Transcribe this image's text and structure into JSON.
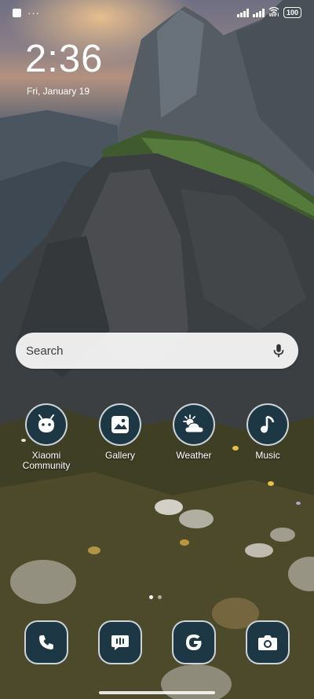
{
  "status_bar": {
    "battery": "100"
  },
  "lock": {
    "time": "2:36",
    "date": "Fri, January 19"
  },
  "search": {
    "placeholder": "Search"
  },
  "apps": [
    {
      "label": "Xiaomi\nCommunity",
      "icon": "xiaomi-community-icon"
    },
    {
      "label": "Gallery",
      "icon": "gallery-icon"
    },
    {
      "label": "Weather",
      "icon": "weather-icon"
    },
    {
      "label": "Music",
      "icon": "music-icon"
    }
  ],
  "dock": [
    {
      "icon": "phone-icon"
    },
    {
      "icon": "messages-icon"
    },
    {
      "icon": "google-icon"
    },
    {
      "icon": "camera-icon"
    }
  ],
  "colors": {
    "icon_bg": "#1d3744",
    "icon_fg": "#ffffff"
  }
}
